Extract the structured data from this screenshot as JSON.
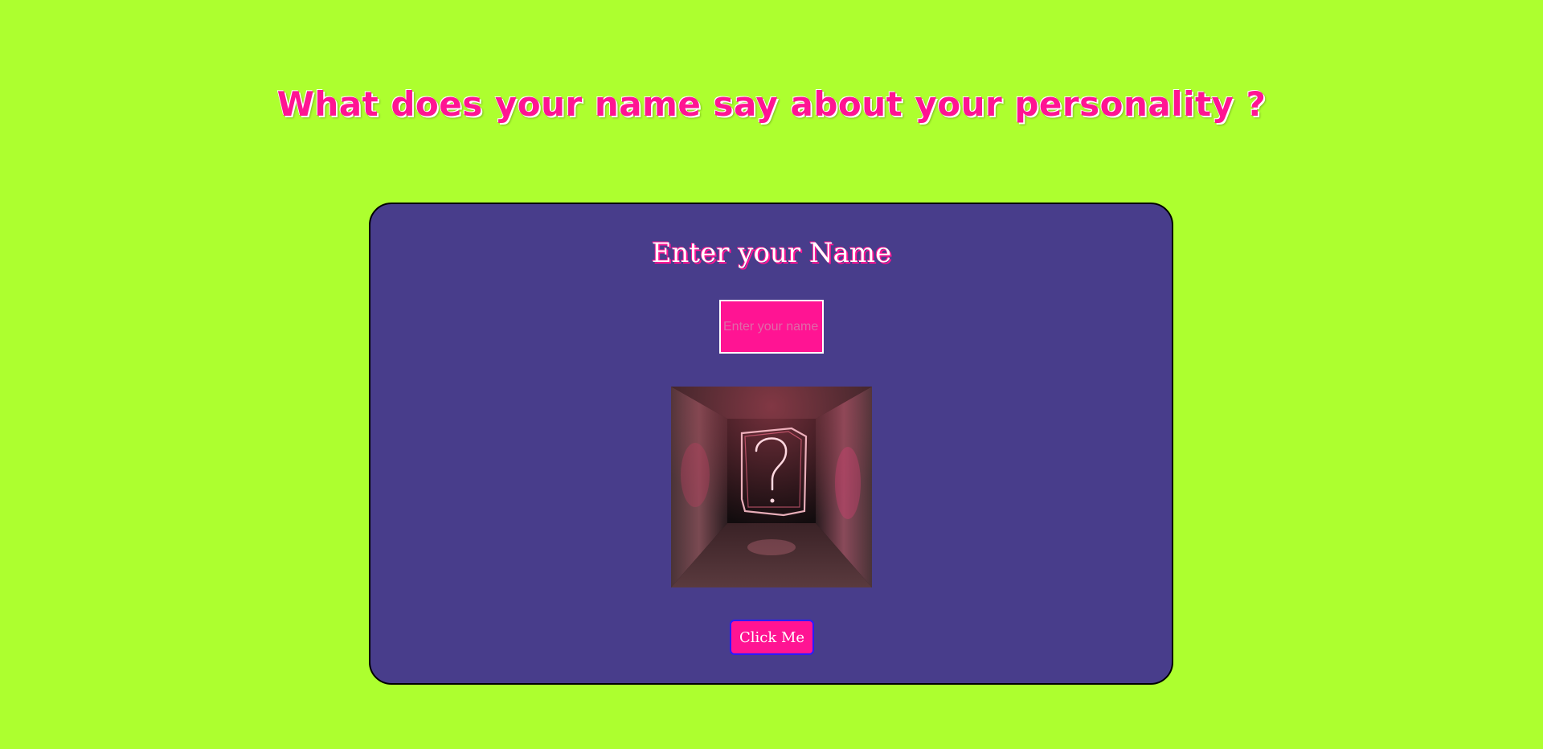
{
  "page": {
    "heading": "What does your name say about your personality ?"
  },
  "card": {
    "title": "Enter your Name",
    "input": {
      "placeholder": "Enter your name",
      "value": ""
    },
    "image": {
      "alt": "question mark light painting"
    },
    "button_label": "Click Me"
  },
  "colors": {
    "background": "#adff2f",
    "card": "#483d8b",
    "accent": "#ff1493",
    "button_border": "#2b1bff"
  }
}
